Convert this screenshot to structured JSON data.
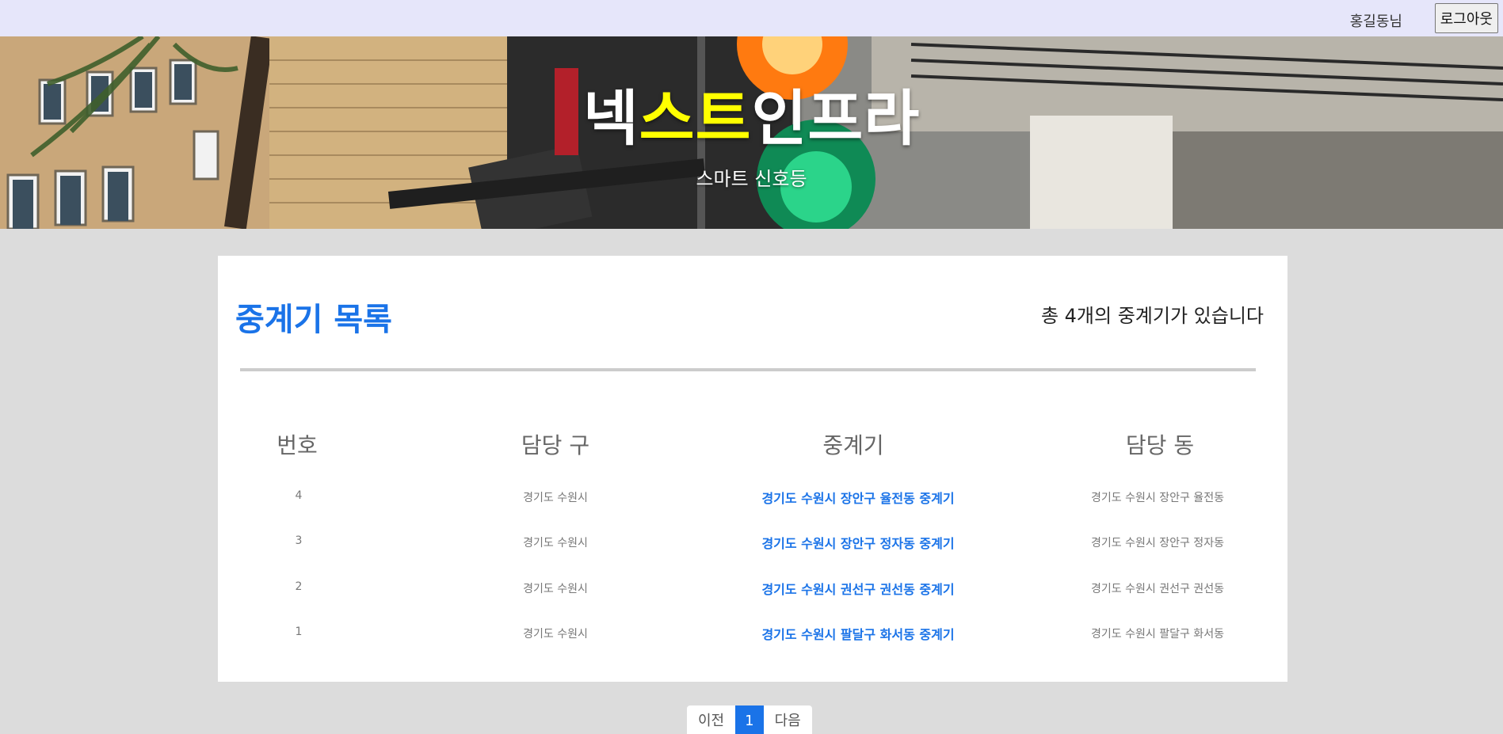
{
  "topbar": {
    "user_name": "홍길동님",
    "logout_label": "로그아웃"
  },
  "hero": {
    "title_part1": "넥",
    "title_highlight": "스트",
    "title_part2": "인프라",
    "subtitle": "스마트 신호등"
  },
  "card": {
    "title": "중계기 목록",
    "total_text": "총 4개의 중계기가 있습니다"
  },
  "table": {
    "headers": [
      "번호",
      "담당 구",
      "중계기",
      "담당 동"
    ],
    "rows": [
      {
        "no": "4",
        "district": "경기도 수원시",
        "relay": "경기도 수원시 장안구 율전동 중계기",
        "dong": "경기도 수원시 장안구 율전동"
      },
      {
        "no": "3",
        "district": "경기도 수원시",
        "relay": "경기도 수원시 장안구 정자동 중계기",
        "dong": "경기도 수원시 장안구 정자동"
      },
      {
        "no": "2",
        "district": "경기도 수원시",
        "relay": "경기도 수원시 권선구 권선동 중계기",
        "dong": "경기도 수원시 권선구 권선동"
      },
      {
        "no": "1",
        "district": "경기도 수원시",
        "relay": "경기도 수원시 팔달구 화서동 중계기",
        "dong": "경기도 수원시 팔달구 화서동"
      }
    ]
  },
  "pagination": {
    "prev_label": "이전",
    "current_page": "1",
    "next_label": "다음"
  }
}
